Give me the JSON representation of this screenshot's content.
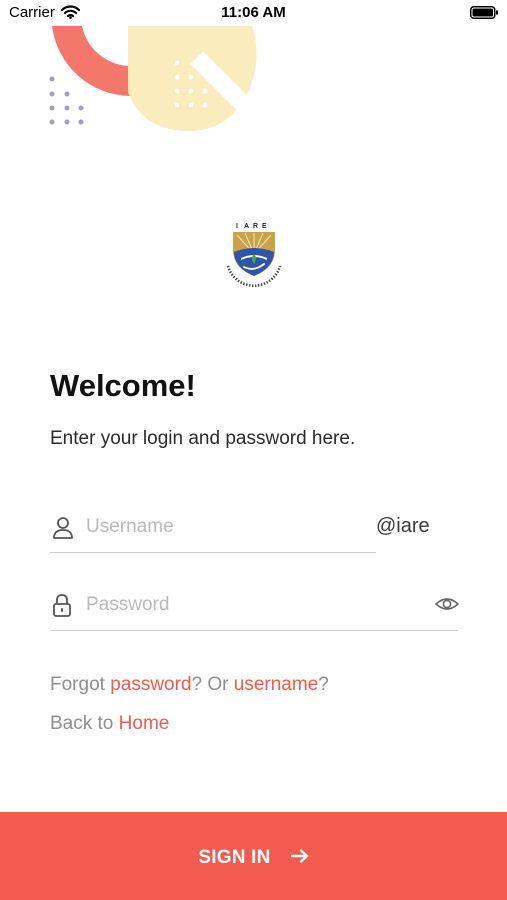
{
  "status_bar": {
    "carrier": "Carrier",
    "time": "11:06 AM"
  },
  "logo": {
    "name": "IARE",
    "motto": "EDUCATION FOR LIBERATION"
  },
  "login": {
    "title": "Welcome!",
    "subtitle": "Enter your login and password here.",
    "username_placeholder": "Username",
    "username_value": "",
    "domain_suffix": "@iare",
    "password_placeholder": "Password",
    "password_value": ""
  },
  "help": {
    "forgot_prefix": "Forgot ",
    "password_link": "password",
    "or_text": "? Or ",
    "username_link": "username",
    "question_mark": "?",
    "back_prefix": "Back to ",
    "home_link": "Home"
  },
  "actions": {
    "sign_in_label": "SIGN IN"
  },
  "icons": {
    "status": [
      "wifi-icon",
      "battery-icon"
    ],
    "fields": [
      "user-icon",
      "lock-icon",
      "eye-icon"
    ],
    "button": "arrow-right-icon"
  },
  "colors": {
    "accent": "#f15b50",
    "decor_coral": "#f4776b",
    "decor_cream": "#fbecbd",
    "decor_dots": "#a79bc4",
    "link": "#f05a4c"
  }
}
